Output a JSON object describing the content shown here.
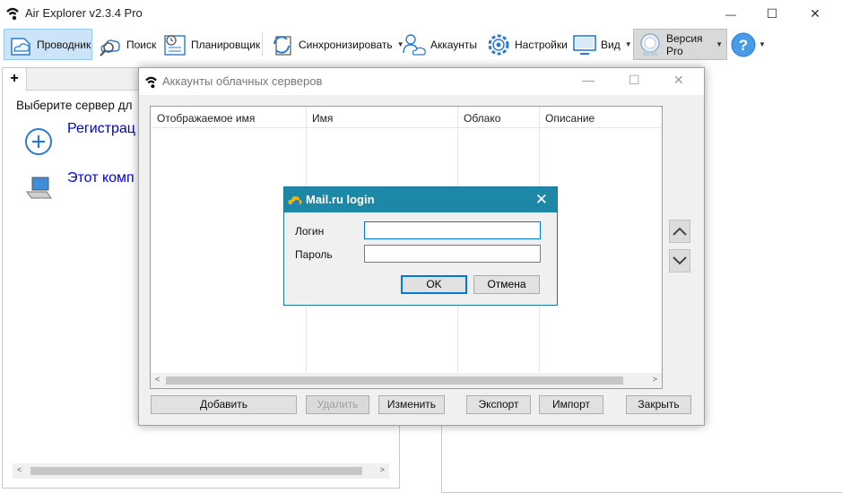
{
  "app": {
    "title": "Air Explorer v2.3.4 Pro",
    "minimize": "—",
    "maximize": "☐",
    "close": "✕"
  },
  "toolbar": {
    "explorer": "Проводник",
    "search": "Поиск",
    "scheduler": "Планировщик",
    "sync": "Синхронизировать",
    "accounts": "Аккаунты",
    "settings": "Настройки",
    "view": "Вид",
    "pro": "Версия Pro",
    "caret": "▼"
  },
  "left_pane": {
    "new_tab": "+",
    "select_label": "Выберите сервер дл",
    "register_link": "Регистрац",
    "this_computer_link": "Этот комп",
    "scroll_left": "<",
    "scroll_right": ">"
  },
  "accounts_dialog": {
    "title": "Аккаунты облачных серверов",
    "columns": [
      "Отображаемое имя",
      "Имя",
      "Облако",
      "Описание"
    ],
    "buttons": {
      "add": "Добавить",
      "delete": "Удалить",
      "edit": "Изменить",
      "export": "Экспорт",
      "import": "Импорт",
      "close": "Закрыть"
    },
    "scroll_left": "<",
    "scroll_right": ">"
  },
  "login_dialog": {
    "title": "Mail.ru login",
    "close": "✕",
    "login_label": "Логин",
    "login_value": "",
    "password_label": "Пароль",
    "password_value": "",
    "ok": "OK",
    "cancel": "Отмена"
  },
  "colors": {
    "accent": "#1d87a7",
    "link": "#0000e0",
    "selected_toolbar": "#cce4f7"
  }
}
